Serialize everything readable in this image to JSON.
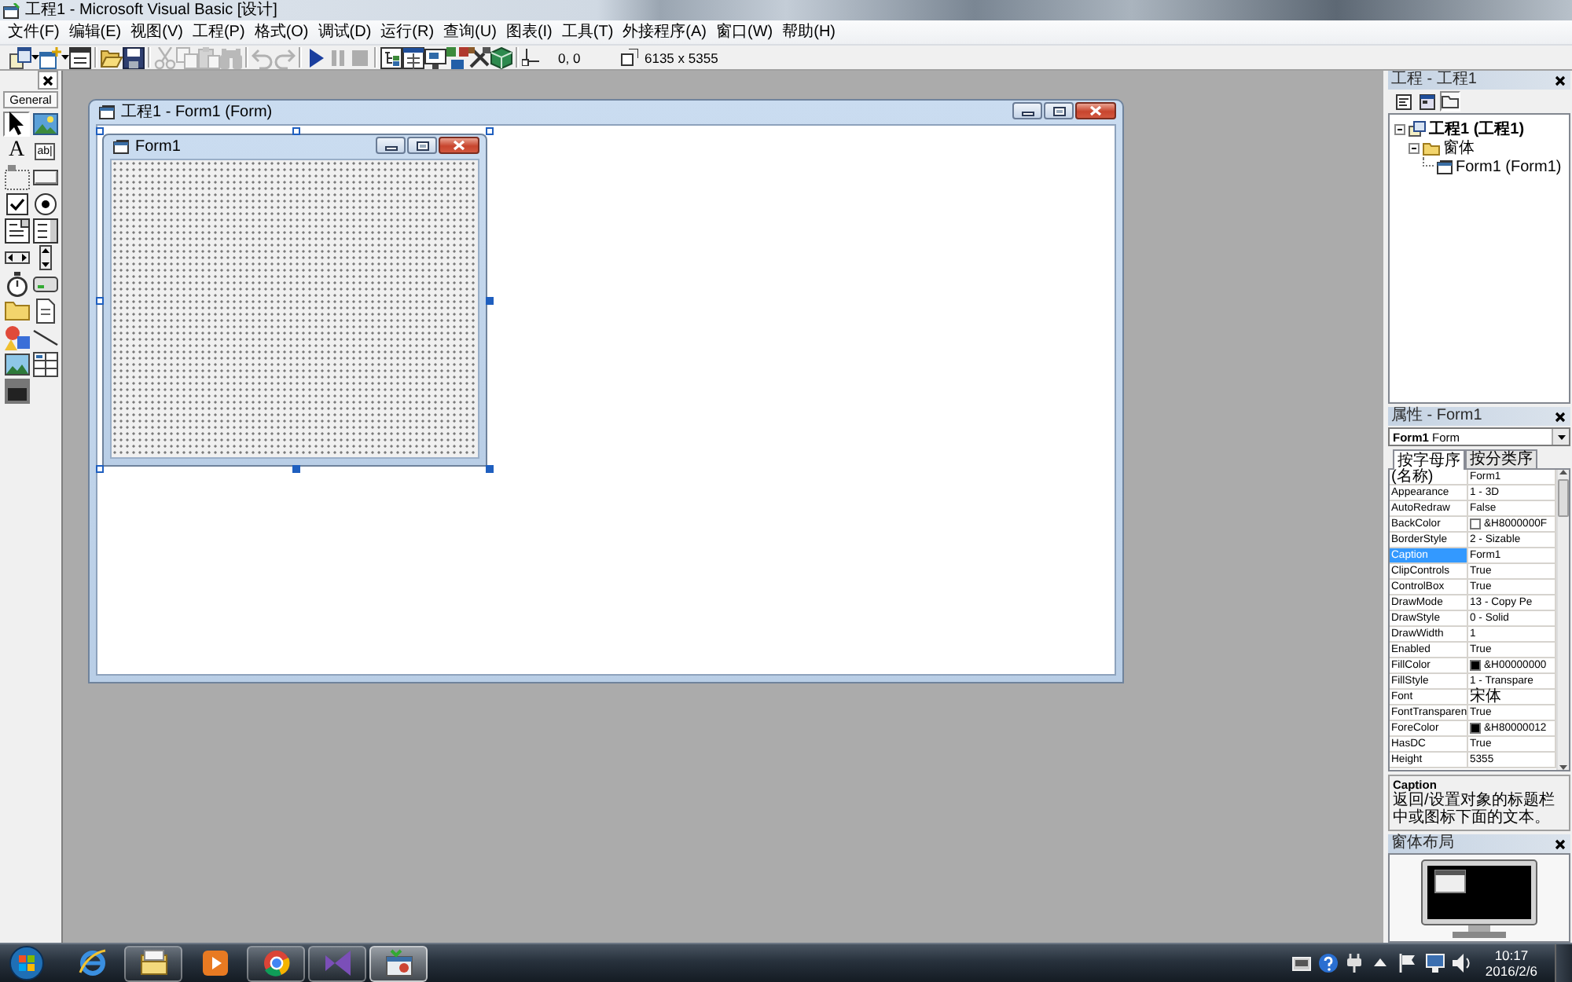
{
  "window": {
    "title": "工程1 - Microsoft Visual Basic [设计]"
  },
  "menu": [
    "文件(F)",
    "编辑(E)",
    "视图(V)",
    "工程(P)",
    "格式(O)",
    "调试(D)",
    "运行(R)",
    "查询(U)",
    "图表(I)",
    "工具(T)",
    "外接程序(A)",
    "窗口(W)",
    "帮助(H)"
  ],
  "toolbar": {
    "groups": [
      {
        "buttons": [
          {
            "disabled": false
          },
          {
            "disabled": false
          },
          {
            "disabled": false
          }
        ]
      },
      {
        "buttons": [
          {
            "disabled": false
          },
          {
            "disabled": false
          }
        ]
      },
      {
        "buttons": [
          {
            "disabled": true
          },
          {
            "disabled": true
          },
          {
            "disabled": true
          },
          {
            "disabled": true
          }
        ]
      },
      {
        "buttons": [
          {
            "disabled": true
          },
          {
            "disabled": true
          }
        ]
      },
      {
        "buttons": [
          {
            "disabled": false
          },
          {
            "disabled": true
          },
          {
            "disabled": true
          }
        ]
      },
      {
        "buttons": [
          {
            "disabled": false
          },
          {
            "disabled": false
          },
          {
            "disabled": false
          },
          {
            "disabled": false
          },
          {
            "disabled": false
          },
          {
            "disabled": false
          }
        ]
      }
    ],
    "position": "0, 0",
    "size": "6135 x 5355"
  },
  "toolbox": {
    "tab": "General",
    "tools": [
      {
        "kind": "icon",
        "selected": true
      },
      {
        "kind": "icon",
        "selected": false
      },
      {
        "kind": "glyph",
        "text": "A",
        "selected": false
      },
      {
        "kind": "field",
        "text": "ab|",
        "selected": false
      },
      {
        "kind": "icon",
        "selected": false
      },
      {
        "kind": "icon",
        "selected": false
      },
      {
        "kind": "icon",
        "selected": false
      },
      {
        "kind": "icon",
        "selected": false
      },
      {
        "kind": "icon",
        "selected": false
      },
      {
        "kind": "icon",
        "selected": false
      },
      {
        "kind": "icon",
        "selected": false
      },
      {
        "kind": "icon",
        "selected": false
      },
      {
        "kind": "icon",
        "selected": false
      },
      {
        "kind": "icon",
        "selected": false
      },
      {
        "kind": "icon",
        "selected": false
      },
      {
        "kind": "icon",
        "selected": false
      },
      {
        "kind": "icon",
        "selected": false
      },
      {
        "kind": "icon",
        "selected": false
      },
      {
        "kind": "icon",
        "selected": false
      },
      {
        "kind": "icon",
        "selected": false
      },
      {
        "kind": "icon",
        "selected": false
      }
    ]
  },
  "designer": {
    "title": "工程1 - Form1 (Form)",
    "form": {
      "caption": "Form1"
    }
  },
  "project": {
    "title": "工程 - 工程1",
    "buttons": [
      {
        "pressed": false
      },
      {
        "pressed": false
      },
      {
        "pressed": true
      }
    ],
    "tree": [
      {
        "label": "工程1 (工程1)",
        "kind": "project",
        "expanded": true,
        "children": [
          {
            "label": "窗体",
            "kind": "folder",
            "expanded": true,
            "children": [
              {
                "label": "Form1 (Form1)",
                "kind": "form"
              }
            ]
          }
        ]
      }
    ]
  },
  "properties": {
    "title": "属性 - Form1",
    "object": "**Form1** Form",
    "tabs": [
      {
        "label": "按字母序",
        "selected": true
      },
      {
        "label": "按分类序",
        "selected": false
      }
    ],
    "rows": [
      {
        "name": "(名称)",
        "value": "Form1",
        "selected": false
      },
      {
        "name": "Appearance",
        "value": "1 - 3D",
        "selected": false
      },
      {
        "name": "AutoRedraw",
        "value": "False",
        "selected": false
      },
      {
        "name": "BackColor",
        "value": "&H8000000F",
        "color": "#ffffff",
        "selected": false
      },
      {
        "name": "BorderStyle",
        "value": "2 - Sizable",
        "selected": false
      },
      {
        "name": "Caption",
        "value": "Form1",
        "selected": true
      },
      {
        "name": "ClipControls",
        "value": "True",
        "selected": false
      },
      {
        "name": "ControlBox",
        "value": "True",
        "selected": false
      },
      {
        "name": "DrawMode",
        "value": "13 - Copy Pe",
        "selected": false
      },
      {
        "name": "DrawStyle",
        "value": "0 - Solid",
        "selected": false
      },
      {
        "name": "DrawWidth",
        "value": "1",
        "selected": false
      },
      {
        "name": "Enabled",
        "value": "True",
        "selected": false
      },
      {
        "name": "FillColor",
        "value": "&H00000000",
        "color": "#000000",
        "selected": false
      },
      {
        "name": "FillStyle",
        "value": "1 - Transpare",
        "selected": false
      },
      {
        "name": "Font",
        "value": "宋体",
        "selected": false
      },
      {
        "name": "FontTransparen",
        "value": "True",
        "selected": false
      },
      {
        "name": "ForeColor",
        "value": "&H80000012",
        "color": "#000000",
        "selected": false
      },
      {
        "name": "HasDC",
        "value": "True",
        "selected": false
      },
      {
        "name": "Height",
        "value": "5355",
        "selected": false
      }
    ],
    "description": {
      "name": "Caption",
      "text": "返回/设置对象的标题栏中或图标下面的文本。"
    }
  },
  "form_layout": {
    "title": "窗体布局"
  },
  "taskbar": {
    "apps": [
      {
        "running": false,
        "selected": false
      },
      {
        "running": true,
        "selected": false
      },
      {
        "running": false,
        "selected": false
      },
      {
        "running": true,
        "selected": false
      },
      {
        "running": true,
        "selected": false
      },
      {
        "running": true,
        "selected": true
      }
    ],
    "time": "10:17",
    "date": "2016/2/6"
  }
}
